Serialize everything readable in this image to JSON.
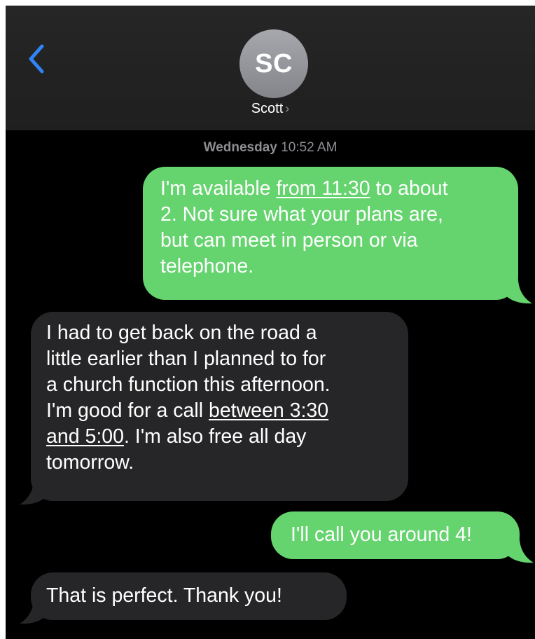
{
  "header": {
    "avatar_initials": "SC",
    "contact_name": "Scott",
    "chevron": "›",
    "back_icon": "chevron-left-icon",
    "accent_color": "#2f84f7"
  },
  "timestamp": {
    "day": "Wednesday",
    "time": "10:52 AM"
  },
  "messages": [
    {
      "direction": "sent",
      "before_link": "I'm available ",
      "link": "from 11:30",
      "after_link": " to about\n2. Not sure what your plans are,\nbut can meet in person or via\ntelephone."
    },
    {
      "direction": "received",
      "before_link": "I had to get back on the road a\nlittle earlier than I planned to for\na church function this afternoon.\nI'm good for a call ",
      "link": "between 3:30\nand 5:00",
      "after_link": ".  I'm also free all day\ntomorrow."
    },
    {
      "direction": "sent",
      "text": "I'll call you around 4!"
    },
    {
      "direction": "received",
      "text": "That is perfect.  Thank you!"
    }
  ],
  "colors": {
    "sent_bubble": "#65d36e",
    "received_bubble": "#262628",
    "background": "#000000",
    "header_bg": "#262626"
  }
}
